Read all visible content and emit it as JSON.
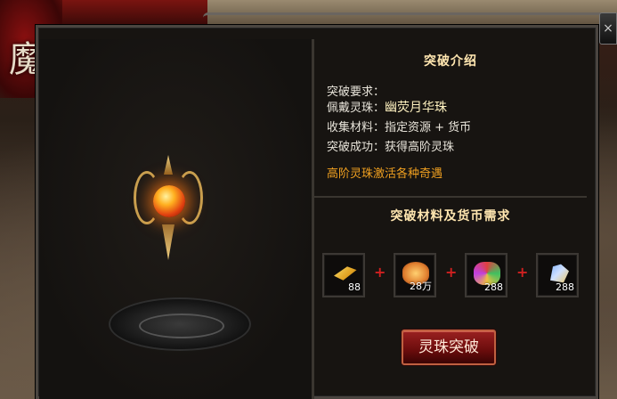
{
  "emblem": {
    "char": "魔"
  },
  "close": {
    "label": "×"
  },
  "intro": {
    "title": "突破介绍",
    "requirement_label": "突破要求：",
    "wear_label": "佩戴灵珠：",
    "wear_value": "幽荧月华珠",
    "materials_label": "收集材料：",
    "materials_value": "指定资源 + 货币",
    "success_label": "突破成功：",
    "success_value": "获得高阶灵珠",
    "note": "高阶灵珠激活各种奇遇"
  },
  "materials": {
    "title": "突破材料及货币需求",
    "items": [
      {
        "icon": "gold-ingot-icon",
        "count": "88"
      },
      {
        "icon": "coin-pouch-icon",
        "count": "28万"
      },
      {
        "icon": "gem-cluster-icon",
        "count": "288"
      },
      {
        "icon": "dragon-token-icon",
        "count": "288"
      }
    ],
    "plus": "+"
  },
  "action": {
    "label": "灵珠突破"
  },
  "colors": {
    "accent_gold": "#ffe6b0",
    "note_orange": "#f0a020",
    "plus_red": "#d02020",
    "button_red": "#9a2020"
  }
}
